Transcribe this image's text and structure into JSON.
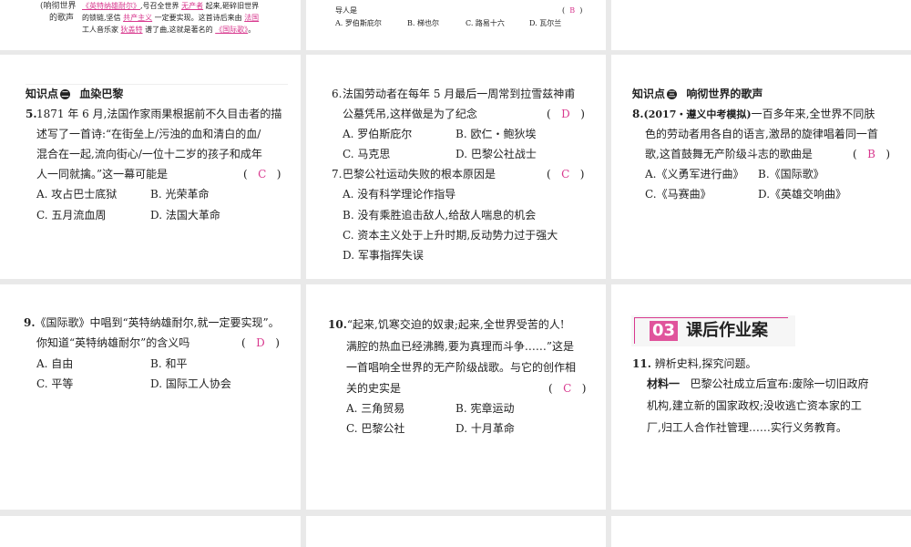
{
  "top_left": {
    "label_lines": [
      "(响彻世界",
      "的歌声"
    ],
    "line1": [
      "《英特纳雄耐尔》",
      ",号召全世界",
      "无产者",
      "起来,砸碎旧世界"
    ],
    "line2": [
      "的锁链,坚信",
      "共产主义",
      "一定要实现。这首诗后来由",
      "法国"
    ],
    "line3": [
      "工人音乐家",
      "狄盖特",
      "谱了曲,这就是著名的",
      "《国际歌》",
      "。"
    ]
  },
  "top_mid": {
    "stem": "导人是",
    "answer": "B",
    "options": [
      "A. 罗伯斯庇尔",
      "B. 梯也尔",
      "C. 路易十六",
      "D. 瓦尔兰"
    ]
  },
  "k2": {
    "prefix": "知识点",
    "num": "二",
    "title": "血染巴黎"
  },
  "q5": {
    "num": "5.",
    "lines": [
      "1871 年 6 月,法国作家雨果根据前不久目击者的描",
      "述写了一首诗:“在街垒上/污浊的血和清白的血/",
      "混合在一起,流向街心/一位十二岁的孩子和成年",
      "人一同就擒。”这一幕可能是"
    ],
    "answer": "C",
    "options": [
      "A. 攻占巴士底狱",
      "B. 光荣革命",
      "C. 五月流血周",
      "D. 法国大革命"
    ]
  },
  "q6": {
    "num": "6.",
    "lines": [
      "法国劳动者在每年 5 月最后一周常到拉雪兹神甫",
      "公墓凭吊,这样做是为了纪念"
    ],
    "answer": "D",
    "options": [
      "A. 罗伯斯庇尔",
      "B. 欧仁・鲍狄埃",
      "C. 马克思",
      "D. 巴黎公社战士"
    ]
  },
  "q7": {
    "num": "7.",
    "lines": [
      "巴黎公社运动失败的根本原因是"
    ],
    "answer": "C",
    "options": [
      "A. 没有科学理论作指导",
      "B. 没有乘胜追击敌人,给敌人喘息的机会",
      "C. 资本主义处于上升时期,反动势力过于强大",
      "D. 军事指挥失误"
    ]
  },
  "k3": {
    "prefix": "知识点",
    "num": "三",
    "title": "响彻世界的歌声"
  },
  "q8": {
    "num": "8.",
    "source": "(2017・遵义中考模拟)",
    "lines": [
      "一百多年来,全世界不同肤",
      "色的劳动者用各自的语言,激昂的旋律唱着同一首",
      "歌,这首鼓舞无产阶级斗志的歌曲是"
    ],
    "answer": "B",
    "options": [
      "A.《义勇军进行曲》",
      "B.《国际歌》",
      "C.《马赛曲》",
      "D.《英雄交响曲》"
    ]
  },
  "q9": {
    "num": "9.",
    "lines": [
      "《国际歌》中唱到“英特纳雄耐尔,就一定要实现”。",
      "你知道“英特纳雄耐尔”的含义吗"
    ],
    "answer": "D",
    "options": [
      "A. 自由",
      "B. 和平",
      "C. 平等",
      "D. 国际工人协会"
    ]
  },
  "q10": {
    "num": "10.",
    "lines": [
      "“起来,饥寒交迫的奴隶;起来,全世界受苦的人!",
      "满腔的热血已经沸腾,要为真理而斗争……”这是",
      "一首唱响全世界的无产阶级战歌。与它的创作相",
      "关的史实是"
    ],
    "answer": "C",
    "options": [
      "A. 三角贸易",
      "B. 宪章运动",
      "C. 巴黎公社",
      "D. 十月革命"
    ]
  },
  "section": {
    "num": "03",
    "title": "课后作业案"
  },
  "q11": {
    "num": "11.",
    "stem": "辨析史料,探究问题。",
    "material_label": "材料一",
    "material_lines": [
      "巴黎公社成立后宣布:废除一切旧政府",
      "机构,建立新的国家政权;没收逃亡资本家的工",
      "厂,归工人合作社管理……实行义务教育。"
    ]
  }
}
